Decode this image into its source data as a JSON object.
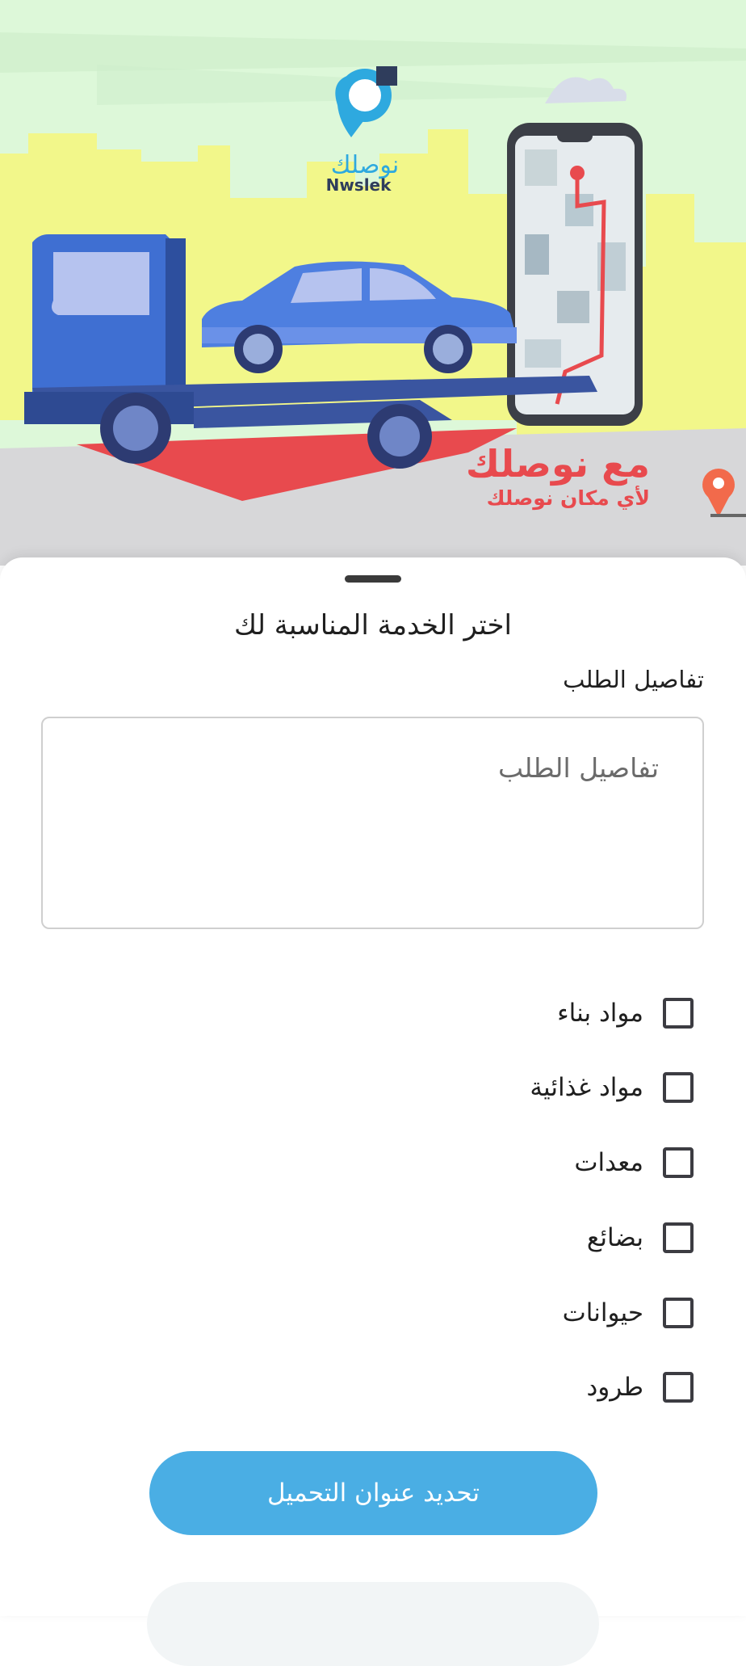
{
  "hero": {
    "brand_arabic": "نوصلك",
    "brand_latin": "Nwslek",
    "slogan_main": "مع نوصلك",
    "slogan_sub": "لأي مكان نوصلك",
    "colors": {
      "sky": "#ddf8d9",
      "wall": "#f2f78a",
      "road": "#d7d7d9",
      "truck": "#3f6fd2",
      "accent": "#e84a4e"
    }
  },
  "sheet": {
    "title": "اختر الخدمة المناسبة لك",
    "details_label": "تفاصيل الطلب",
    "details_placeholder": "تفاصيل الطلب",
    "details_value": ""
  },
  "services": [
    {
      "label": "مواد بناء",
      "checked": false
    },
    {
      "label": "مواد غذائية",
      "checked": false
    },
    {
      "label": "معدات",
      "checked": false
    },
    {
      "label": "بضائع",
      "checked": false
    },
    {
      "label": "حيوانات",
      "checked": false
    },
    {
      "label": "طرود",
      "checked": false
    }
  ],
  "actions": {
    "primary_label": "تحديد عنوان التحميل",
    "primary_color": "#4aaee4"
  }
}
